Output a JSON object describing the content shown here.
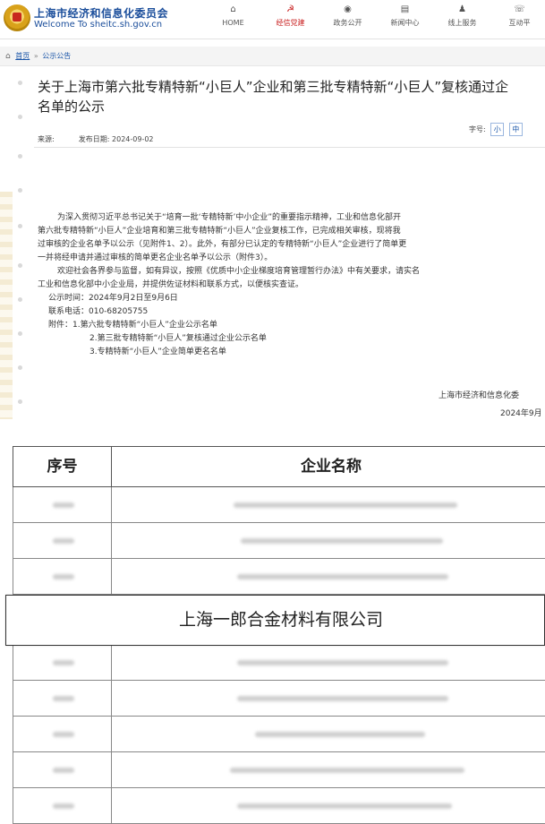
{
  "header": {
    "site_title": "上海市经济和信息化委员会",
    "site_subtitle": "Welcome To sheitc.sh.gov.cn",
    "nav": [
      {
        "icon": "⌂",
        "label": "HOME",
        "active": false
      },
      {
        "icon": "☭",
        "label": "经信党建",
        "active": true
      },
      {
        "icon": "◉",
        "label": "政务公开",
        "active": false
      },
      {
        "icon": "▤",
        "label": "新闻中心",
        "active": false
      },
      {
        "icon": "♟",
        "label": "线上服务",
        "active": false
      },
      {
        "icon": "☏",
        "label": "互动平",
        "active": false
      }
    ]
  },
  "breadcrumb": {
    "home": "首页",
    "separator": "»",
    "current": "公示公告"
  },
  "article": {
    "title_line1": "关于上海市第六批专精特新“小巨人”企业和第三批专精特新“小巨人”复核通过企",
    "title_line2": "名单的公示",
    "source_label": "来源:",
    "date_label": "发布日期: 2024-09-02",
    "font_size_label": "字号:",
    "font_small": "小",
    "font_medium": "中",
    "paragraphs": [
      "为深入贯彻习近平总书记关于“培育一批‘专精特新’中小企业”的重要指示精神，工业和信息化部开",
      "第六批专精特新“小巨人”企业培育和第三批专精特新“小巨人”企业复核工作，已完成相关审核，现将我",
      "过审核的企业名单予以公示（见附件1、2）。此外，有部分已认定的专精特新“小巨人”企业进行了简单更",
      "一并将经申请并通过审核的简单更名企业名单予以公示（附件3）。",
      "欢迎社会各界参与监督，如有异议，按照《优质中小企业梯度培育管理暂行办法》中有关要求，请实名",
      "工业和信息化部中小企业局，并提供佐证材料和联系方式，以便核实查证。",
      "公示时间：2024年9月2日至9月6日",
      "联系电话：010-68205755",
      "附件：1.第六批专精特新“小巨人”企业公示名单",
      "2.第三批专精特新“小巨人”复核通过企业公示名单",
      "3.专精特新“小巨人”企业简单更名名单"
    ],
    "signature": "上海市经济和信息化委",
    "sign_date": "2024年9月"
  },
  "table": {
    "col_no": "序号",
    "col_name": "企业名称",
    "highlighted_company": "上海一郎合金材料有限公司"
  },
  "colors": {
    "brand_blue": "#1b4e9b",
    "active_red": "#c81e1e",
    "link_blue": "#1a55a8"
  }
}
